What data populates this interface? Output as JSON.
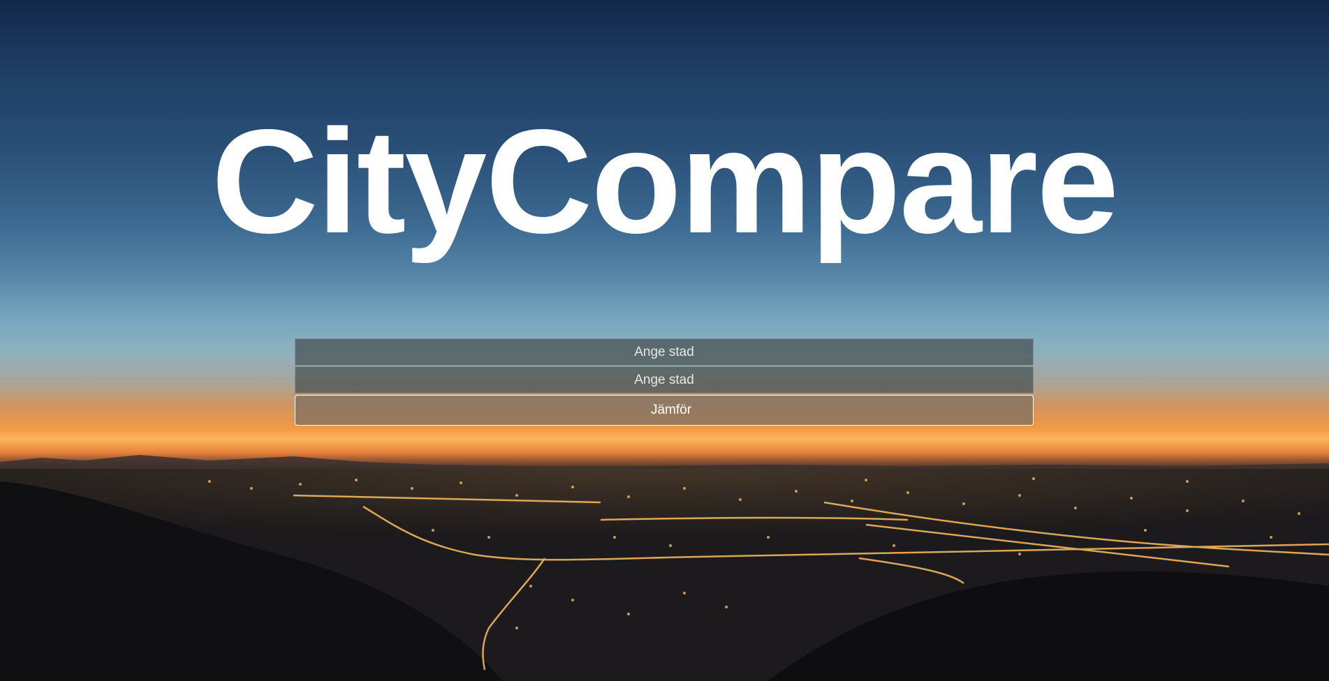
{
  "header": {
    "title": "CityCompare"
  },
  "form": {
    "city1_placeholder": "Ange stad",
    "city2_placeholder": "Ange stad",
    "compare_label": "Jämför"
  },
  "colors": {
    "sky_top": "#13294a",
    "horizon_glow": "#fdb55b",
    "city_lights": "#ffc468",
    "title_text": "#ffffff"
  }
}
